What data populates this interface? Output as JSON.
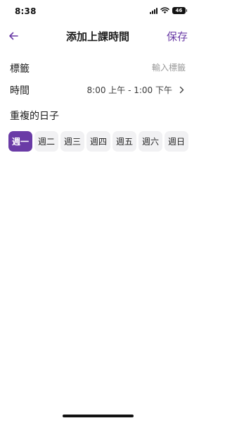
{
  "status_bar": {
    "time": "8:38",
    "battery": "46",
    "icons": [
      "signal-icon",
      "wifi-icon",
      "battery-icon"
    ]
  },
  "header": {
    "back_icon": "arrow-left-icon",
    "title": "添加上課時間",
    "save_label": "保存"
  },
  "form": {
    "label_row": {
      "label": "標籤",
      "value": "",
      "placeholder": "輸入標籤"
    },
    "time_row": {
      "label": "時間",
      "value": "8:00 上午 - 1:00 下午",
      "icon": "chevron-right-icon"
    }
  },
  "repeat": {
    "title": "重複的日子",
    "days": [
      {
        "label": "週一",
        "selected": true
      },
      {
        "label": "週二",
        "selected": false
      },
      {
        "label": "週三",
        "selected": false
      },
      {
        "label": "週四",
        "selected": false
      },
      {
        "label": "週五",
        "selected": false
      },
      {
        "label": "週六",
        "selected": false
      },
      {
        "label": "週日",
        "selected": false
      }
    ]
  },
  "colors": {
    "accent": "#6a3ba6",
    "chip_background": "#f1f1f3",
    "placeholder_text": "#9a9a9a",
    "background": "#ffffff"
  }
}
